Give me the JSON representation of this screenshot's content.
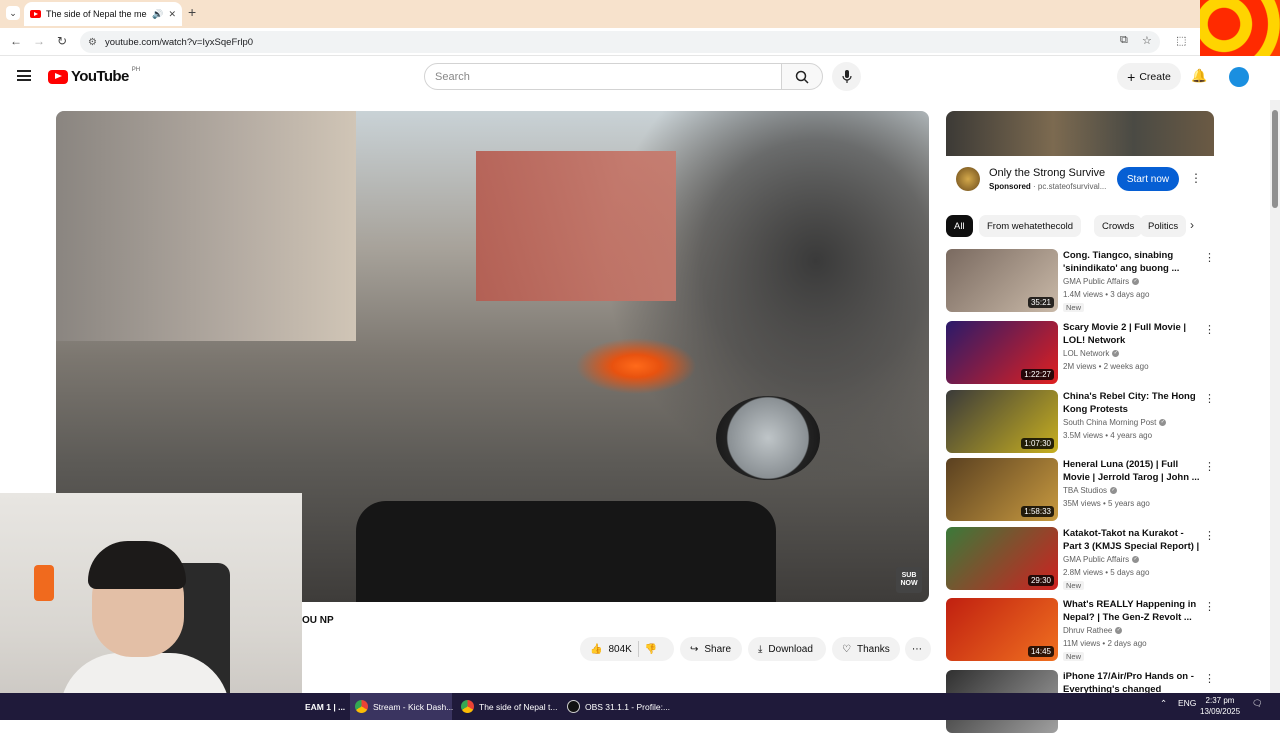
{
  "browser": {
    "tab_title": "The side of Nepal the medi",
    "url": "youtube.com/watch?v=IyxSqeFrlp0"
  },
  "youtube": {
    "logo_text": "YouTube",
    "country_code": "PH",
    "search_placeholder": "Search",
    "create_label": "Create"
  },
  "player": {
    "watermark": "SUB NOW"
  },
  "video": {
    "title_fragment": "OU NP",
    "like_count": "804K",
    "share_label": "Share",
    "download_label": "Download",
    "thanks_label": "Thanks"
  },
  "ad": {
    "title": "Only the Strong Survive",
    "sponsored": "Sponsored",
    "domain": "pc.stateofsurvival...",
    "cta": "Start now"
  },
  "chips": [
    "All",
    "From wehatethecold",
    "Crowds",
    "Politics"
  ],
  "recommendations": [
    {
      "title": "Cong. Tiangco, sinabing 'sinindikato' ang buong ...",
      "channel": "GMA Public Affairs",
      "views": "1.4M views",
      "age": "3 days ago",
      "duration": "35:21",
      "new": "New",
      "colors": [
        "#7a6a60",
        "#c9b9a8"
      ]
    },
    {
      "title": "Scary Movie 2 | Full Movie | LOL! Network",
      "channel": "LOL Network",
      "views": "2M views",
      "age": "2 weeks ago",
      "duration": "1:22:27",
      "new": "",
      "colors": [
        "#2a1a6a",
        "#e02020"
      ]
    },
    {
      "title": "China's Rebel City: The Hong Kong Protests",
      "channel": "South China Morning Post",
      "views": "3.5M views",
      "age": "4 years ago",
      "duration": "1:07:30",
      "new": "",
      "colors": [
        "#3a3a3a",
        "#c8b020"
      ]
    },
    {
      "title": "Heneral Luna (2015) | Full Movie | Jerrold Tarog | John ...",
      "channel": "TBA Studios",
      "views": "35M views",
      "age": "5 years ago",
      "duration": "1:58:33",
      "new": "",
      "colors": [
        "#5a4020",
        "#c89a40"
      ]
    },
    {
      "title": "Katakot-Takot na Kurakot - Part 3 (KMJS Special Report) | ...",
      "channel": "GMA Public Affairs",
      "views": "2.8M views",
      "age": "5 days ago",
      "duration": "29:30",
      "new": "New",
      "colors": [
        "#3a7a3a",
        "#d02020"
      ]
    },
    {
      "title": "What's REALLY Happening in Nepal? | The Gen-Z Revolt ...",
      "channel": "Dhruv Rathee",
      "views": "11M views",
      "age": "2 days ago",
      "duration": "14:45",
      "new": "New",
      "colors": [
        "#c02010",
        "#f07020"
      ]
    },
    {
      "title": "iPhone 17/Air/Pro Hands on - Everything's changed",
      "channel": "",
      "views": "",
      "age": "",
      "duration": "",
      "new": "",
      "colors": [
        "#303030",
        "#a0a0a0"
      ]
    }
  ],
  "taskbar": {
    "items": [
      "EAM 1 | ...",
      "Stream - Kick Dash...",
      "The side of Nepal t...",
      "OBS 31.1.1 - Profile:..."
    ],
    "lang": "ENG",
    "time": "2:37 pm",
    "date": "13/09/2025"
  }
}
